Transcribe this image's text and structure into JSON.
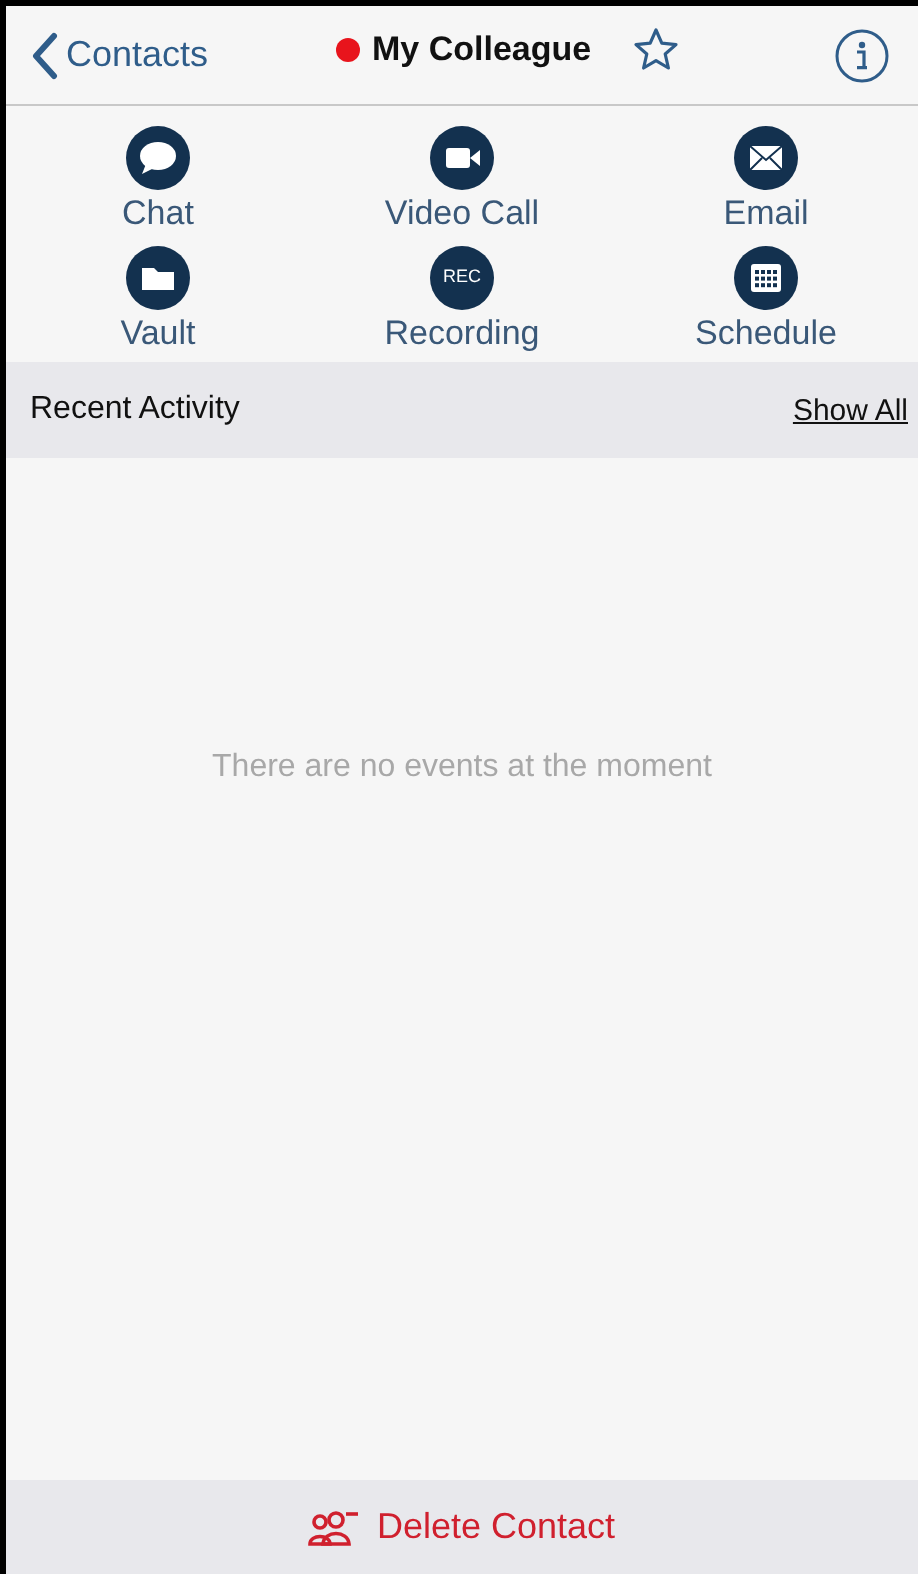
{
  "nav": {
    "back_label": "Contacts",
    "title": "My Colleague",
    "available": false,
    "favorite": false
  },
  "actions": [
    {
      "kind": "chat",
      "label": "Chat"
    },
    {
      "kind": "video",
      "label": "Video Call"
    },
    {
      "kind": "email",
      "label": "Email"
    },
    {
      "kind": "vault",
      "label": "Vault"
    },
    {
      "kind": "rec",
      "label": "Recording",
      "icon_text": "REC"
    },
    {
      "kind": "schedule",
      "label": "Schedule"
    }
  ],
  "recent_activity": {
    "title": "Recent Activity",
    "link": "Show All",
    "empty_message": "There are no events at the moment"
  },
  "footer": {
    "button": "Delete Contact"
  }
}
